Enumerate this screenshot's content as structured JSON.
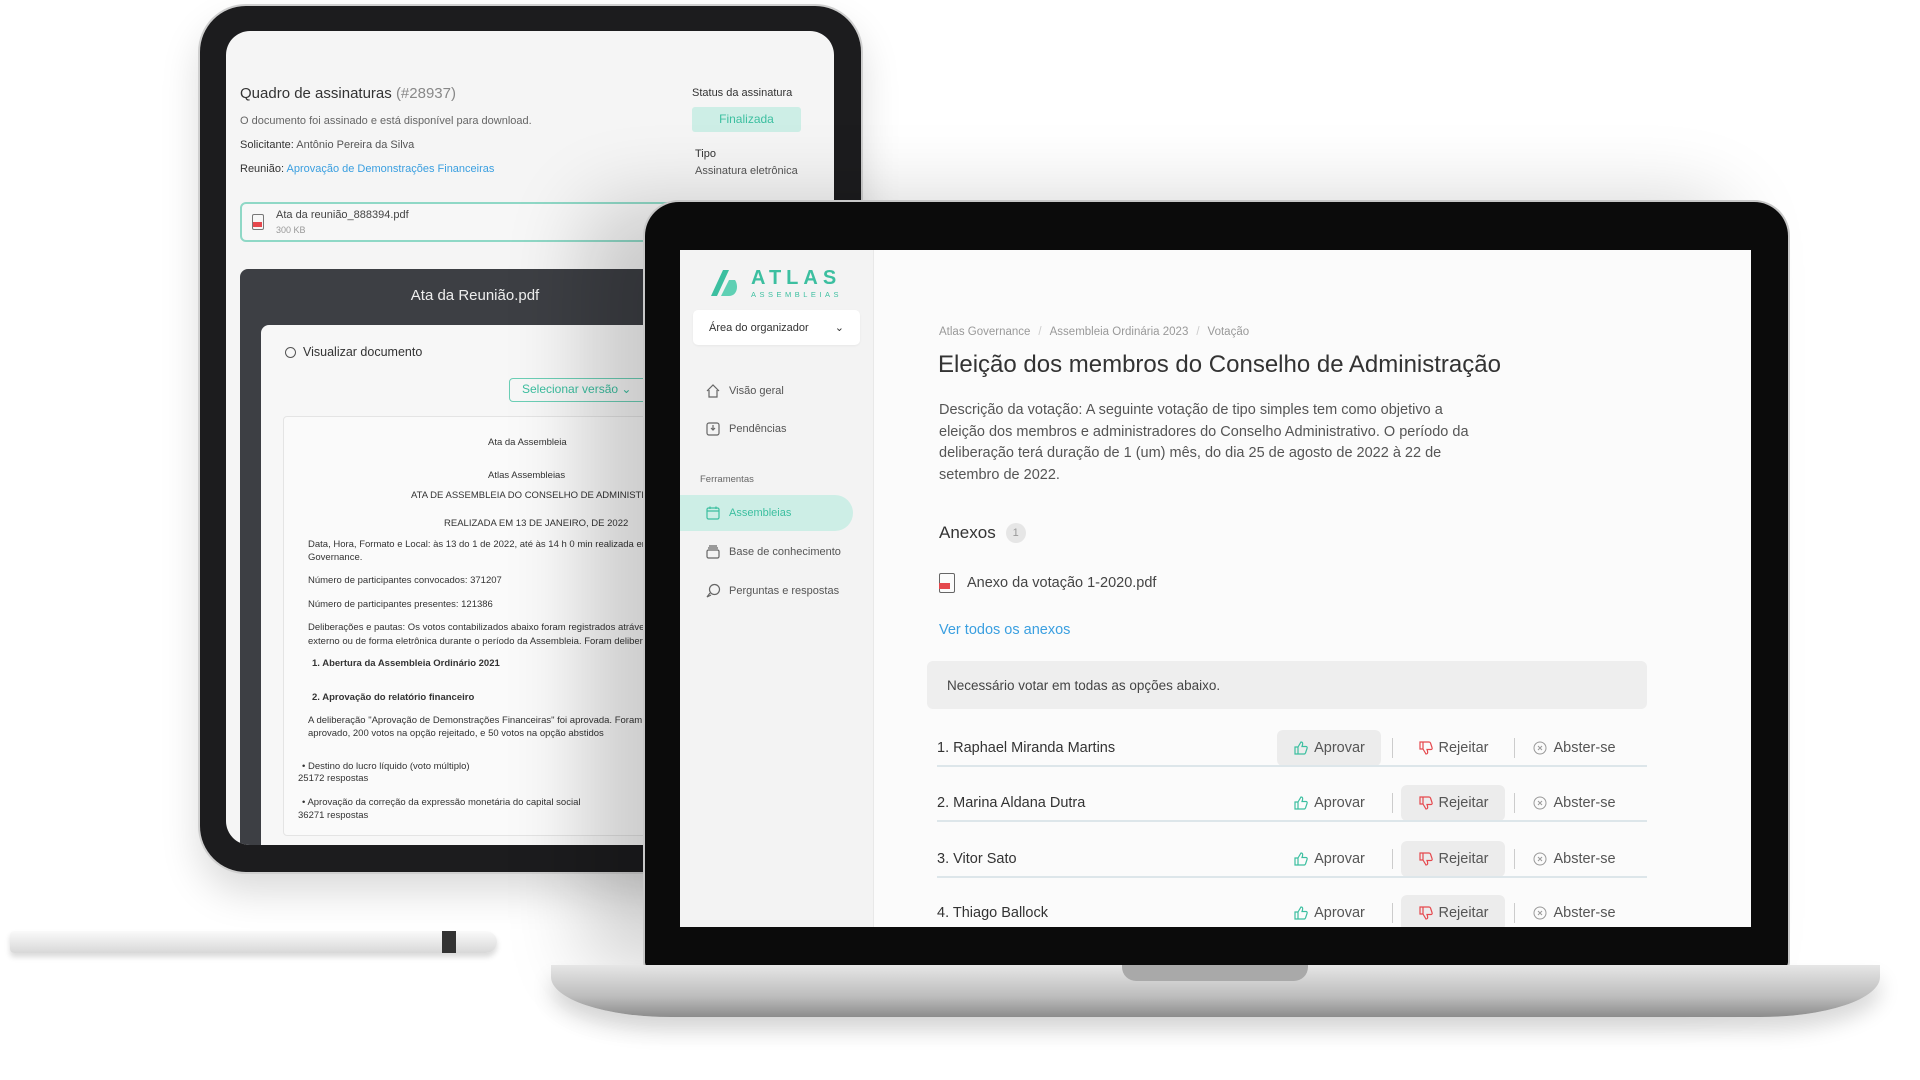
{
  "tablet": {
    "title": "Quadro de assinaturas",
    "doc_id": "(#28937)",
    "message": "O  documento foi assinado e está disponível para download.",
    "requester_label": "Solicitante:",
    "requester": "Antônio Pereira da Silva",
    "meeting_label": "Reunião:",
    "meeting_link": "Aprovação de Demonstrações Financeiras",
    "status_label": "Status da assinatura",
    "status": "Finalizada",
    "type_label": "Tipo",
    "type": "Assinatura eletrônica",
    "file": {
      "name": "Ata da reunião_888394.pdf",
      "size": "300 KB"
    },
    "viewer": {
      "title": "Ata da Reunião.pdf",
      "search_label": "Visualizar documento",
      "version_select": "Selecionar versão",
      "doc_lines": [
        "Ata da Assembleia",
        "Atlas Assembleias",
        "ATA DE ASSEMBLEIA DO CONSELHO DE ADMINISTRAÇÃO",
        "REALIZADA EM 13 DE JANEIRO, DE 2022",
        "Data, Hora, Formato e Local: às 13 do 1 de 2022, até às 14 h 0 min realizada em formato",
        "Governance.",
        "Número de participantes convocados: 371207",
        "Número de participantes presentes: 121386",
        "Deliberações e pautas: Os votos contabilizados abaixo foram registrados atrávez do Bol",
        "externo ou de forma eletrônica durante o período da Assembleia. Foram deliberados sob",
        "1. Abertura da Assembleia Ordinário 2021",
        "2. Aprovação do relatório financeiro",
        "A deliberação \"Aprovação de Demonstrações Financeiras\" foi aprovada. Foram registrad",
        "aprovado, 200 votos na opção rejeitado, e 50 votos na opção abstidos",
        "•  Destino do lucro líquido (voto múltiplo)",
        "25172 respostas",
        "•  Aprovação da correção da expressão monetária do capital social",
        "36271 respostas"
      ]
    }
  },
  "laptop": {
    "logo": {
      "name": "ATLAS",
      "sub": "ASSEMBLEIAS",
      "color": "#3cbfa0"
    },
    "area_select": "Área do organizador",
    "nav": [
      {
        "label": "Visão geral",
        "icon": "home-icon"
      },
      {
        "label": "Pendências",
        "icon": "inbox-icon"
      }
    ],
    "tools_label": "Ferramentas",
    "tools": [
      {
        "label": "Assembleias",
        "icon": "calendar-icon",
        "active": true
      },
      {
        "label": "Base de conhecimento",
        "icon": "archive-icon"
      },
      {
        "label": "Perguntas e respostas",
        "icon": "chat-icon"
      }
    ],
    "breadcrumb": [
      "Atlas Governance",
      "Assembleia Ordinária 2023",
      "Votação"
    ],
    "title": "Eleição dos membros do Conselho de Administração",
    "description": [
      "Descrição da votação: A seguinte votação de tipo simples tem como objetivo a",
      "eleição dos membros e administradores do Conselho Administrativo. O período da",
      "deliberação terá duração de 1 (um) mês, do dia 25 de agosto de 2022 à 22 de",
      "setembro de 2022."
    ],
    "attachments_label": "Anexos",
    "attachments_count": "1",
    "attachment": "Anexo da votação 1-2020.pdf",
    "see_all": "Ver todos os anexos",
    "notice": "Necessário votar em todas as opções abaixo.",
    "vote_labels": {
      "approve": "Aprovar",
      "reject": "Rejeitar",
      "abstain": "Abster-se"
    },
    "candidates": [
      {
        "name": "1. Raphael Miranda Martins",
        "selected": "approve"
      },
      {
        "name": "2. Marina Aldana Dutra",
        "selected": "reject"
      },
      {
        "name": "3. Vitor Sato",
        "selected": "reject"
      },
      {
        "name": "4. Thiago Ballock",
        "selected": "reject"
      }
    ],
    "colors": {
      "accent": "#3cbfa0",
      "link": "#3a9fe0",
      "reject": "#e5484d"
    }
  }
}
